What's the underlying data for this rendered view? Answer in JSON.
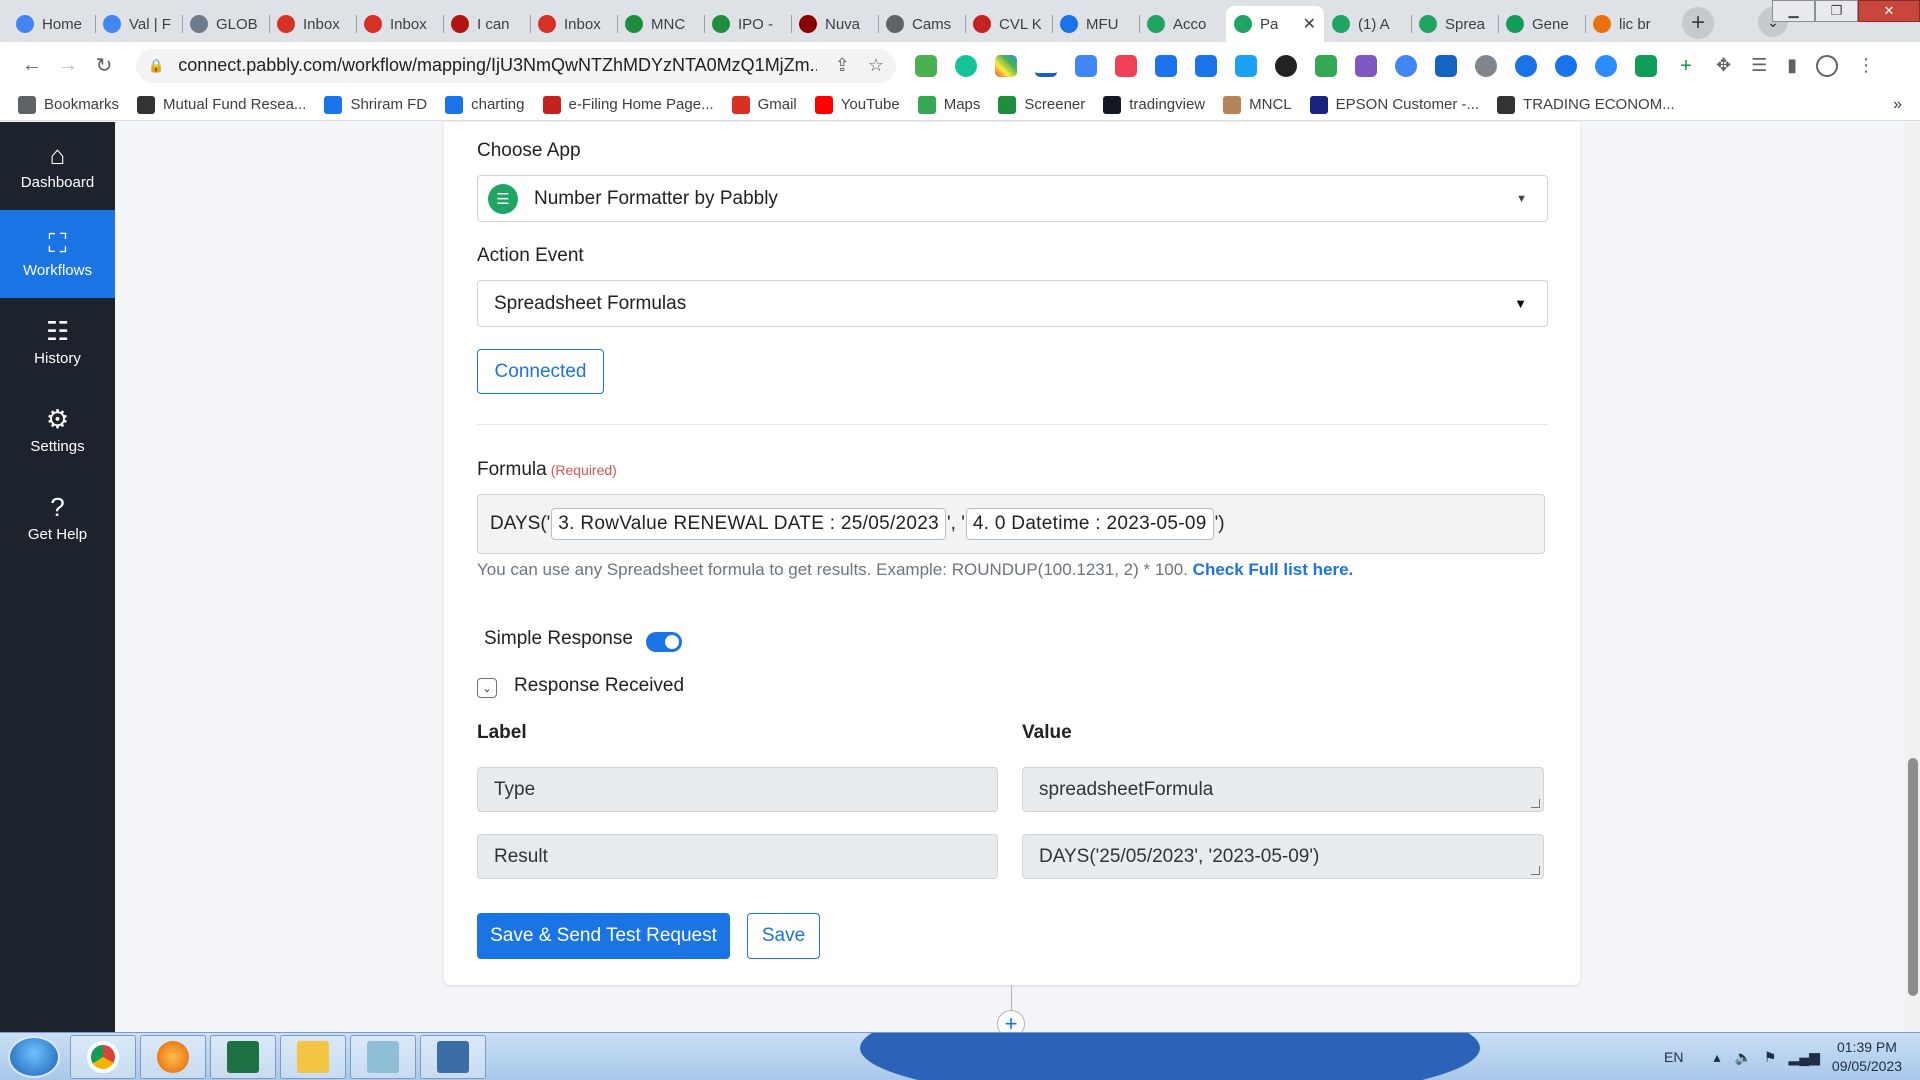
{
  "browser": {
    "tabs": [
      {
        "label": "Home",
        "color": "#4285f4",
        "icon": "edge-icon"
      },
      {
        "label": "Val | F",
        "color": "#4285f4",
        "icon": "edge-icon"
      },
      {
        "label": "GLOB",
        "color": "#6c7a89",
        "icon": "globe-icon"
      },
      {
        "label": "Inbox",
        "color": "#d93025",
        "icon": "gmail-icon"
      },
      {
        "label": "Inbox",
        "color": "#d93025",
        "icon": "gmail-icon"
      },
      {
        "label": "I can",
        "color": "#b31412",
        "icon": "news-icon"
      },
      {
        "label": "Inbox",
        "color": "#d93025",
        "icon": "gmail-icon"
      },
      {
        "label": "MNC",
        "color": "#1e8e3e",
        "icon": "m-icon"
      },
      {
        "label": "IPO -",
        "color": "#1e8e3e",
        "icon": "m-icon"
      },
      {
        "label": "Nuva",
        "color": "#8b0000",
        "icon": "chart-icon"
      },
      {
        "label": "Cams",
        "color": "#5f6368",
        "icon": "globe-icon"
      },
      {
        "label": "CVL K",
        "color": "#c5221f",
        "icon": "cvl-icon"
      },
      {
        "label": "MFU",
        "color": "#1a73e8",
        "icon": "mfu-icon"
      },
      {
        "label": "Acco",
        "color": "#20a464",
        "icon": "pabbly-icon"
      },
      {
        "label": "Pa",
        "color": "#20a464",
        "icon": "pabbly-icon",
        "active": true
      },
      {
        "label": "(1) A",
        "color": "#20a464",
        "icon": "pabbly-icon"
      },
      {
        "label": "Sprea",
        "color": "#20a464",
        "icon": "pabbly-icon"
      },
      {
        "label": "Gene",
        "color": "#0f9d58",
        "icon": "sheets-plus-icon"
      },
      {
        "label": "lic br",
        "color": "#e8710a",
        "icon": "lic-icon"
      }
    ],
    "url": "connect.pabbly.com/workflow/mapping/IjU3NmQwNTZhMDYzNTA0MzQ1MjZm...",
    "bookmarks": [
      {
        "label": "Bookmarks",
        "icon": "star-icon",
        "color": "#5f6368"
      },
      {
        "label": "Mutual Fund Resea...",
        "icon": "mf-icon",
        "color": "#333333"
      },
      {
        "label": "Shriram FD",
        "icon": "shriram-icon",
        "color": "#1a73e8"
      },
      {
        "label": "charting",
        "icon": "ci-icon",
        "color": "#1a73e8"
      },
      {
        "label": "e-Filing Home Page...",
        "icon": "efiling-icon",
        "color": "#c5221f"
      },
      {
        "label": "Gmail",
        "icon": "gmail-icon",
        "color": "#d93025"
      },
      {
        "label": "YouTube",
        "icon": "youtube-icon",
        "color": "#ff0000"
      },
      {
        "label": "Maps",
        "icon": "maps-icon",
        "color": "#34a853"
      },
      {
        "label": "Screener",
        "icon": "screener-icon",
        "color": "#1e8e3e"
      },
      {
        "label": "tradingview",
        "icon": "tradingview-icon",
        "color": "#131722"
      },
      {
        "label": "MNCL",
        "icon": "mncl-icon",
        "color": "#b5835a"
      },
      {
        "label": "EPSON Customer -...",
        "icon": "epson-icon",
        "color": "#1a237e"
      },
      {
        "label": "TRADING ECONOM...",
        "icon": "te-icon",
        "color": "#333333"
      }
    ]
  },
  "sidebar": {
    "items": [
      {
        "label": "Dashboard",
        "icon": "home-icon"
      },
      {
        "label": "Workflows",
        "icon": "workflow-icon",
        "active": true
      },
      {
        "label": "History",
        "icon": "history-icon"
      },
      {
        "label": "Settings",
        "icon": "gear-icon"
      },
      {
        "label": "Get Help",
        "icon": "help-icon"
      }
    ]
  },
  "form": {
    "choose_app_label": "Choose App",
    "app_name": "Number Formatter by Pabbly",
    "action_event_label": "Action Event",
    "action_event": "Spreadsheet Formulas",
    "connected_label": "Connected",
    "formula_label": "Formula",
    "required_label": "(Required)",
    "formula": {
      "prefix": "DAYS('",
      "chip1": "3. RowValue RENEWAL DATE : 25/05/2023",
      "sep": "', '",
      "chip2": "4. 0 Datetime : 2023-05-09",
      "suffix": "')"
    },
    "hint_text": "You can use any Spreadsheet formula to get results. Example: ROUNDUP(100.1231, 2) * 100.",
    "hint_link": "Check Full list here.",
    "simple_response_label": "Simple Response",
    "simple_response_on": true,
    "response_received_label": "Response Received",
    "label_col": "Label",
    "value_col": "Value",
    "rows": [
      {
        "label": "Type",
        "value": "spreadsheetFormula"
      },
      {
        "label": "Result",
        "value": "DAYS('25/05/2023', '2023-05-09')"
      }
    ],
    "save_test_label": "Save & Send Test Request",
    "save_label": "Save"
  },
  "taskbar": {
    "lang": "EN",
    "time": "01:39 PM",
    "date": "09/05/2023"
  },
  "colors": {
    "accent": "#1b74e4",
    "sidebar_bg": "#1d232c",
    "required": "#d9534f"
  }
}
